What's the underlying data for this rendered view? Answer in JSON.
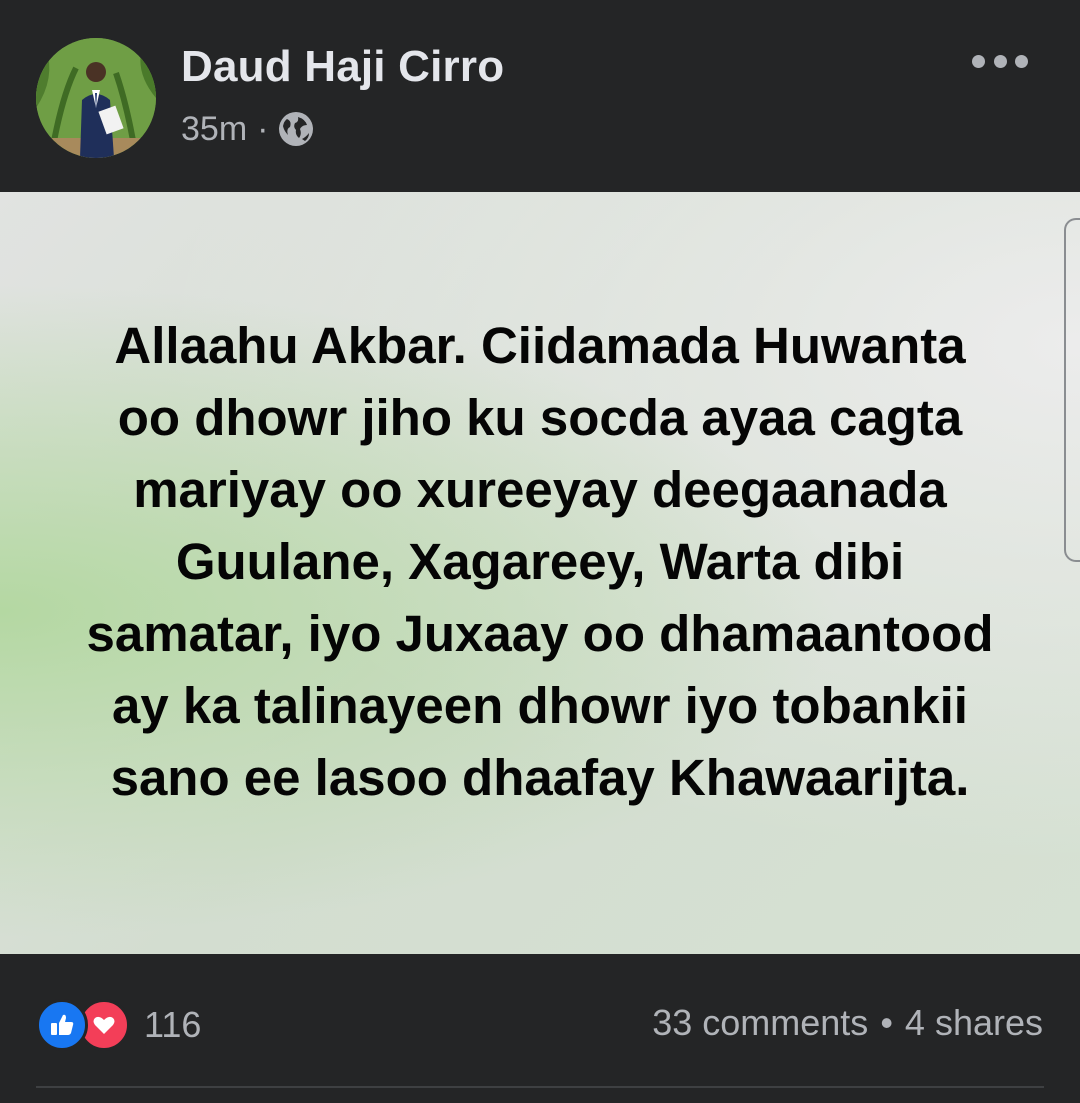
{
  "post": {
    "author": "Daud Haji Cirro",
    "time": "35m",
    "separator": "·",
    "privacy_icon": "globe-icon",
    "more_icon": "more-options-icon",
    "text": "Allaahu Akbar. Ciidamada Huwanta oo dhowr jiho ku socda ayaa cagta mariyay oo xureeyay deegaanada Guulane, Xagareey, Warta dibi samatar, iyo Juxaay oo dhamaantood ay ka talinayeen dhowr iyo tobankii sano ee lasoo dhaafay Khawaarijta.",
    "background_colors": [
      "#e1e3e1",
      "#b4d8a2",
      "#ececec"
    ]
  },
  "reactions": {
    "icons": [
      "like-icon",
      "love-icon"
    ],
    "count": "116"
  },
  "stats": {
    "comments": "33 comments",
    "bullet": "•",
    "shares": "4 shares"
  },
  "colors": {
    "background": "#242526",
    "primary_text": "#e4e6eb",
    "secondary_text": "#b0b3b8",
    "like": "#1877f2",
    "love": "#f33e58"
  }
}
